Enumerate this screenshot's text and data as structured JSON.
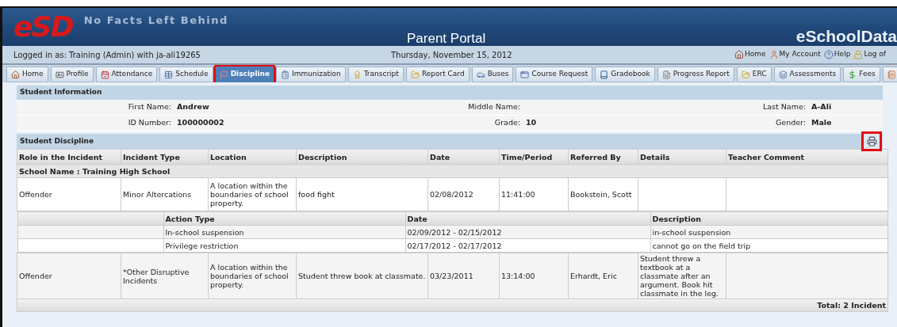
{
  "header": {
    "logo": "eSD",
    "tagline": "No Facts Left Behind",
    "title": "Parent Portal",
    "brand": "eSchoolData"
  },
  "user_bar": {
    "logged_in": "Logged in as: Training (Admin) with ja-ali19265",
    "date": "Thursday, November 15, 2012",
    "links": [
      "Home",
      "My Account",
      "Help",
      "Log of"
    ]
  },
  "tabs": [
    {
      "label": "Home",
      "selected": false
    },
    {
      "label": "Profile",
      "selected": false
    },
    {
      "label": "Attendance",
      "selected": false
    },
    {
      "label": "Schedule",
      "selected": false
    },
    {
      "label": "Discipline",
      "selected": true
    },
    {
      "label": "Immunization",
      "selected": false
    },
    {
      "label": "Transcript",
      "selected": false
    },
    {
      "label": "Report Card",
      "selected": false
    },
    {
      "label": "Buses",
      "selected": false
    },
    {
      "label": "Course Request",
      "selected": false
    },
    {
      "label": "Gradebook",
      "selected": false
    },
    {
      "label": "Progress Report",
      "selected": false
    },
    {
      "label": "ERC",
      "selected": false
    },
    {
      "label": "Assessments",
      "selected": false
    },
    {
      "label": "Fees",
      "selected": false
    }
  ],
  "student_information": {
    "title": "Student Information",
    "fields": [
      {
        "label": "First Name:",
        "value": "Andrew"
      },
      {
        "label": "Middle Name:"
      },
      {
        "label": "Last Name:",
        "value": "A-Ali"
      },
      {
        "label": "ID Number:",
        "value": "100000002"
      },
      {
        "label": "Grade:",
        "value": "10"
      },
      {
        "label": "Gender:",
        "value": "Male"
      }
    ]
  },
  "student_discipline": {
    "title": "Student Discipline",
    "print_highlighted": true,
    "columns": [
      "Role in the Incident",
      "Incident Type",
      "Location",
      "Description",
      "Date",
      "Time/Period",
      "Referred By",
      "Details",
      "Teacher Comment"
    ],
    "school": "School Name : Training High School",
    "incidents": [
      {
        "cells": [
          "Offender",
          "Minor Altercations",
          "A location within the boundaries of school property.",
          "food fight",
          "02/08/2012",
          "11:41:00",
          "Bookstein, Scott",
          null,
          null
        ],
        "action_columns": [
          "Action Type",
          "Date",
          "Description"
        ],
        "actions": [
          [
            "In-school suspension",
            "02/09/2012 - 02/15/2012",
            "in-school suspension"
          ],
          [
            "Privilege restriction",
            "02/17/2012 - 02/17/2012",
            "cannot go on the field trip"
          ]
        ]
      },
      {
        "cells": [
          "Offender",
          "*Other Disruptive Incidents",
          "A location within the boundaries of school property.",
          "Student threw book at classmate.",
          "03/23/2011",
          "13:14:00",
          "Erhardt, Eric",
          "Student threw a textbook at a classmate after an argument. Book hit classmate in the leg.",
          null
        ]
      }
    ],
    "total": "Total: 2 Incident"
  }
}
